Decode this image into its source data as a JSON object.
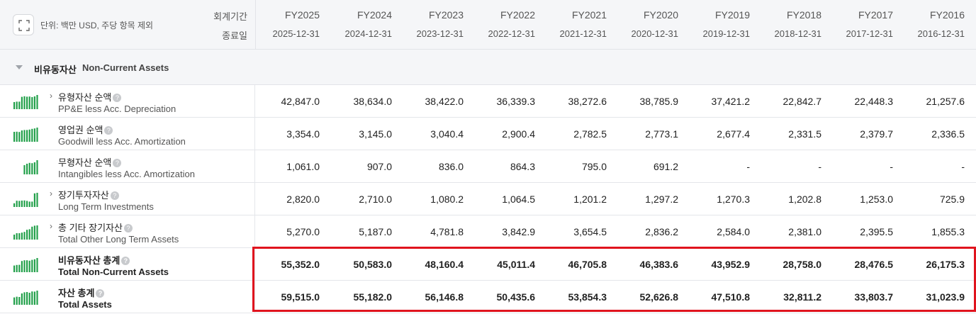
{
  "header": {
    "unit_label": "단위: 백만 USD, 주당 항목 제외",
    "fiscal_label": "회계기간",
    "end_date_label": "종료일",
    "years": [
      {
        "fy": "FY2025",
        "date": "2025-12-31"
      },
      {
        "fy": "FY2024",
        "date": "2024-12-31"
      },
      {
        "fy": "FY2023",
        "date": "2023-12-31"
      },
      {
        "fy": "FY2022",
        "date": "2022-12-31"
      },
      {
        "fy": "FY2021",
        "date": "2021-12-31"
      },
      {
        "fy": "FY2020",
        "date": "2020-12-31"
      },
      {
        "fy": "FY2019",
        "date": "2019-12-31"
      },
      {
        "fy": "FY2018",
        "date": "2018-12-31"
      },
      {
        "fy": "FY2017",
        "date": "2017-12-31"
      },
      {
        "fy": "FY2016",
        "date": "2016-12-31"
      }
    ]
  },
  "section": {
    "ko": "비유동자산",
    "en": "Non-Current Assets"
  },
  "rows": [
    {
      "ko": "유형자산 순액",
      "en": "PP&E less Acc. Depreciation",
      "expandable": true,
      "total": false,
      "values": [
        "42,847.0",
        "38,634.0",
        "38,422.0",
        "36,339.3",
        "38,272.6",
        "38,785.9",
        "37,421.2",
        "22,842.7",
        "22,448.3",
        "21,257.6"
      ],
      "spark": [
        0.5,
        0.53,
        0.53,
        0.87,
        0.91,
        0.88,
        0.89,
        0.85,
        0.9,
        1.0
      ]
    },
    {
      "ko": "영업권 순액",
      "en": "Goodwill less Acc. Amortization",
      "expandable": false,
      "total": false,
      "values": [
        "3,354.0",
        "3,145.0",
        "3,040.4",
        "2,900.4",
        "2,782.5",
        "2,773.1",
        "2,677.4",
        "2,331.5",
        "2,379.7",
        "2,336.5"
      ],
      "spark": [
        0.7,
        0.71,
        0.69,
        0.8,
        0.83,
        0.83,
        0.86,
        0.91,
        0.94,
        1.0
      ]
    },
    {
      "ko": "무형자산 순액",
      "en": "Intangibles less Acc. Amortization",
      "expandable": false,
      "total": false,
      "values": [
        "1,061.0",
        "907.0",
        "836.0",
        "864.3",
        "795.0",
        "691.2",
        "-",
        "-",
        "-",
        "-"
      ],
      "spark": [
        0,
        0,
        0,
        0,
        0.65,
        0.75,
        0.81,
        0.79,
        0.85,
        1.0
      ]
    },
    {
      "ko": "장기투자자산",
      "en": "Long Term Investments",
      "expandable": true,
      "total": false,
      "values": [
        "2,820.0",
        "2,710.0",
        "1,080.2",
        "1,064.5",
        "1,201.2",
        "1,297.2",
        "1,270.3",
        "1,202.8",
        "1,253.0",
        "725.9"
      ],
      "spark": [
        0.26,
        0.44,
        0.43,
        0.45,
        0.46,
        0.43,
        0.38,
        0.38,
        0.96,
        1.0
      ]
    },
    {
      "ko": "총 기타 장기자산",
      "en": "Total Other Long Term Assets",
      "expandable": true,
      "total": false,
      "values": [
        "5,270.0",
        "5,187.0",
        "4,781.8",
        "3,842.9",
        "3,654.5",
        "2,836.2",
        "2,584.0",
        "2,381.0",
        "2,395.5",
        "1,855.3"
      ],
      "spark": [
        0.35,
        0.45,
        0.45,
        0.49,
        0.54,
        0.69,
        0.73,
        0.91,
        0.98,
        1.0
      ]
    },
    {
      "ko": "비유동자산 총계",
      "en": "Total Non-Current Assets",
      "expandable": false,
      "total": true,
      "values": [
        "55,352.0",
        "50,583.0",
        "48,160.4",
        "45,011.4",
        "46,705.8",
        "46,383.6",
        "43,952.9",
        "28,758.0",
        "28,476.5",
        "26,175.3"
      ],
      "spark": [
        0.47,
        0.51,
        0.52,
        0.79,
        0.84,
        0.84,
        0.81,
        0.87,
        0.91,
        1.0
      ]
    },
    {
      "ko": "자산 총계",
      "en": "Total Assets",
      "expandable": false,
      "total": true,
      "values": [
        "59,515.0",
        "55,182.0",
        "56,146.8",
        "50,435.6",
        "53,854.3",
        "52,626.8",
        "47,510.8",
        "32,811.2",
        "33,803.7",
        "31,023.9"
      ],
      "spark": [
        0.52,
        0.57,
        0.55,
        0.8,
        0.88,
        0.9,
        0.85,
        0.94,
        0.93,
        1.0
      ]
    }
  ],
  "colors": {
    "spark": "#22a04a",
    "highlight": "#e0141e"
  }
}
